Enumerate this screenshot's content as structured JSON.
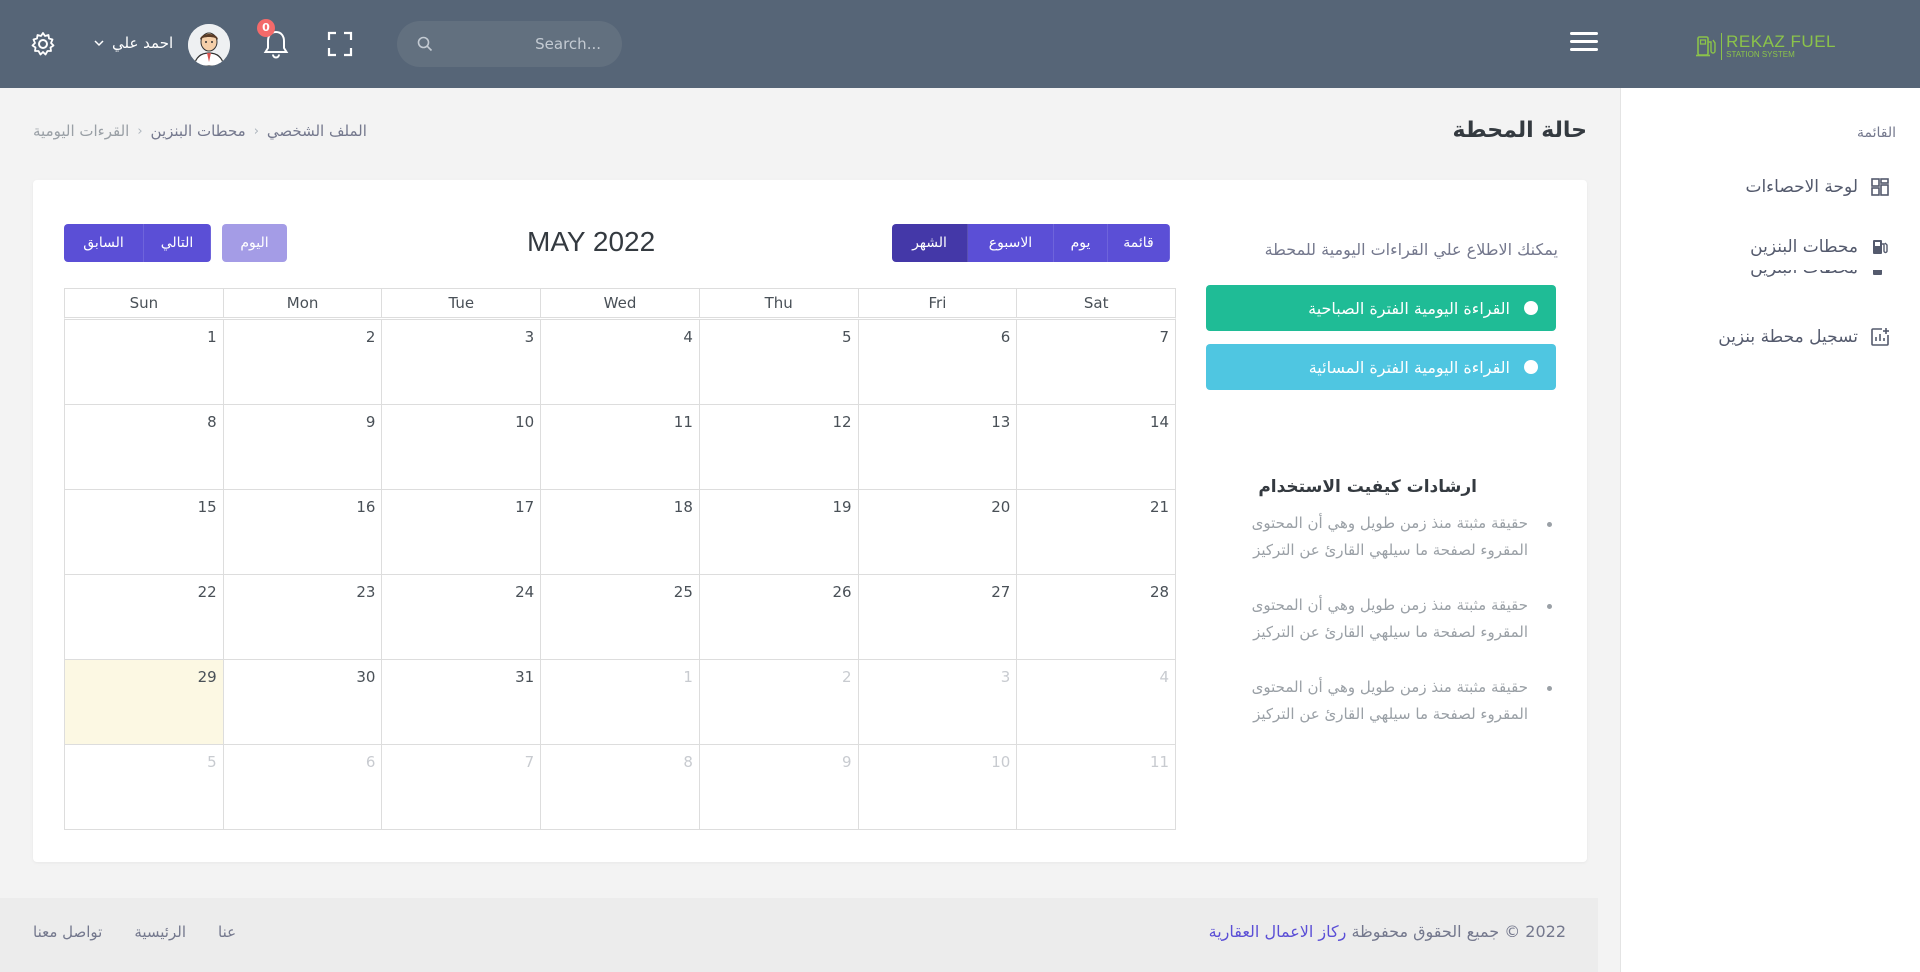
{
  "brand": {
    "name": "REKAZ FUEL",
    "tagline": "STATION SYSTEM",
    "color": "#8bc34a"
  },
  "topbar": {
    "search_placeholder": "Search...",
    "notifications_count": "0",
    "user_name": "احمد علي",
    "bg_color": "#566577"
  },
  "sidebar": {
    "title": "القائمة",
    "items": [
      {
        "label": "لوحة الاحصاءات",
        "icon": "dashboard-icon"
      },
      {
        "label": "محطات البنزين",
        "icon": "gas-pump-icon"
      },
      {
        "label": "تسجيل محطة بنزين",
        "icon": "add-chart-icon"
      }
    ]
  },
  "page": {
    "title": "حالة المحطة",
    "breadcrumb": [
      "الملف الشخصي",
      "محطات البنزين",
      "القرءات اليومية"
    ]
  },
  "panel": {
    "info_text": "يمكنك الاطلاع علي القراءات اليومية للمحطة",
    "events": [
      {
        "label": "القراءة اليومية الفترة الصباحية",
        "color": "#1fbc96"
      },
      {
        "label": "القراءة اليومية الفترة المسائية",
        "color": "#4fc6e1"
      }
    ],
    "guide_title": "ارشادات كيفيت الاستخدام",
    "guide_items": [
      "حقيقة مثبتة منذ زمن طويل وهي أن المحتوى المقروء لصفحة ما سيلهي القارئ عن التركيز",
      "حقيقة مثبتة منذ زمن طويل وهي أن المحتوى المقروء لصفحة ما سيلهي القارئ عن التركيز",
      "حقيقة مثبتة منذ زمن طويل وهي أن المحتوى المقروء لصفحة ما سيلهي القارئ عن التركيز"
    ]
  },
  "calendar": {
    "title": "MAY 2022",
    "view_buttons": [
      "الشهر",
      "الاسبوع",
      "يوم",
      "قائمة"
    ],
    "active_view": "الشهر",
    "today_label": "اليوم",
    "next_label": "التالي",
    "prev_label": "السابق",
    "weekdays": [
      "Sun",
      "Mon",
      "Tue",
      "Wed",
      "Thu",
      "Fri",
      "Sat"
    ],
    "weeks": [
      [
        {
          "d": "1"
        },
        {
          "d": "2"
        },
        {
          "d": "3"
        },
        {
          "d": "4"
        },
        {
          "d": "5"
        },
        {
          "d": "6"
        },
        {
          "d": "7"
        }
      ],
      [
        {
          "d": "8"
        },
        {
          "d": "9"
        },
        {
          "d": "10"
        },
        {
          "d": "11"
        },
        {
          "d": "12"
        },
        {
          "d": "13"
        },
        {
          "d": "14"
        }
      ],
      [
        {
          "d": "15"
        },
        {
          "d": "16"
        },
        {
          "d": "17"
        },
        {
          "d": "18"
        },
        {
          "d": "19"
        },
        {
          "d": "20"
        },
        {
          "d": "21"
        }
      ],
      [
        {
          "d": "22"
        },
        {
          "d": "23"
        },
        {
          "d": "24"
        },
        {
          "d": "25"
        },
        {
          "d": "26"
        },
        {
          "d": "27"
        },
        {
          "d": "28"
        }
      ],
      [
        {
          "d": "29",
          "today": true
        },
        {
          "d": "30"
        },
        {
          "d": "31"
        },
        {
          "d": "1",
          "other": true
        },
        {
          "d": "2",
          "other": true
        },
        {
          "d": "3",
          "other": true
        },
        {
          "d": "4",
          "other": true
        }
      ],
      [
        {
          "d": "5",
          "other": true
        },
        {
          "d": "6",
          "other": true
        },
        {
          "d": "7",
          "other": true
        },
        {
          "d": "8",
          "other": true
        },
        {
          "d": "9",
          "other": true
        },
        {
          "d": "10",
          "other": true
        },
        {
          "d": "11",
          "other": true
        }
      ]
    ],
    "accent_color": "#5b4fd6",
    "today_bg": "#fcf8e3"
  },
  "footer": {
    "copyright_prefix": "2022 © جميع الحقوق محفوظة",
    "copyright_brand": "ركاز الاعمال العقارية",
    "links": [
      "عنا",
      "الرئيسية",
      "تواصل معنا"
    ]
  }
}
